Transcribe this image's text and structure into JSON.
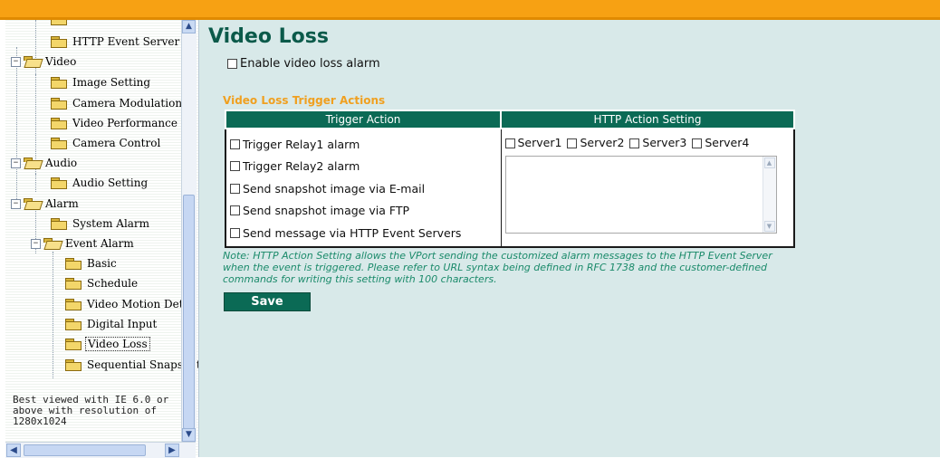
{
  "nav": {
    "items": [
      {
        "label": "HTTP Event Server"
      },
      {
        "label": "Video"
      },
      {
        "label": "Image Setting"
      },
      {
        "label": "Camera Modulation"
      },
      {
        "label": "Video Performance"
      },
      {
        "label": "Camera Control"
      },
      {
        "label": "Audio"
      },
      {
        "label": "Audio Setting"
      },
      {
        "label": "Alarm"
      },
      {
        "label": "System Alarm"
      },
      {
        "label": "Event Alarm"
      },
      {
        "label": "Basic"
      },
      {
        "label": "Schedule"
      },
      {
        "label": "Video Motion Detec"
      },
      {
        "label": "Digital Input"
      },
      {
        "label": "Video Loss"
      },
      {
        "label": "Sequential Snapshot"
      }
    ],
    "toggle_minus": "−",
    "best_viewed": "Best viewed with IE 6.0 or above with resolution of 1280x1024"
  },
  "main": {
    "title": "Video Loss",
    "enable_label": "Enable video loss alarm",
    "section_title": "Video Loss Trigger Actions",
    "col_trigger": "Trigger Action",
    "col_http": "HTTP Action Setting",
    "actions": [
      {
        "label": "Trigger Relay1 alarm"
      },
      {
        "label": "Trigger Relay2 alarm"
      },
      {
        "label": "Send snapshot image via E-mail"
      },
      {
        "label": "Send snapshot image via FTP"
      },
      {
        "label": "Send message via HTTP Event Servers"
      }
    ],
    "servers": [
      {
        "label": "Server1"
      },
      {
        "label": "Server2"
      },
      {
        "label": "Server3"
      },
      {
        "label": "Server4"
      }
    ],
    "message_value": "",
    "note": "Note: HTTP Action Setting allows the VPort sending the customized alarm messages to the HTTP Event Server when the event is triggered. Please refer to URL syntax being defined in RFC 1738 and the customer-defined commands for writing this setting with 100 characters.",
    "save_label": "Save"
  },
  "colors": {
    "topbar": "#f7a113",
    "content_bg": "#d8e9e9",
    "header_green": "#0b6a55",
    "title_green": "#0b5a4a",
    "section_orange": "#f0a020",
    "note_green": "#1a8a6a"
  }
}
